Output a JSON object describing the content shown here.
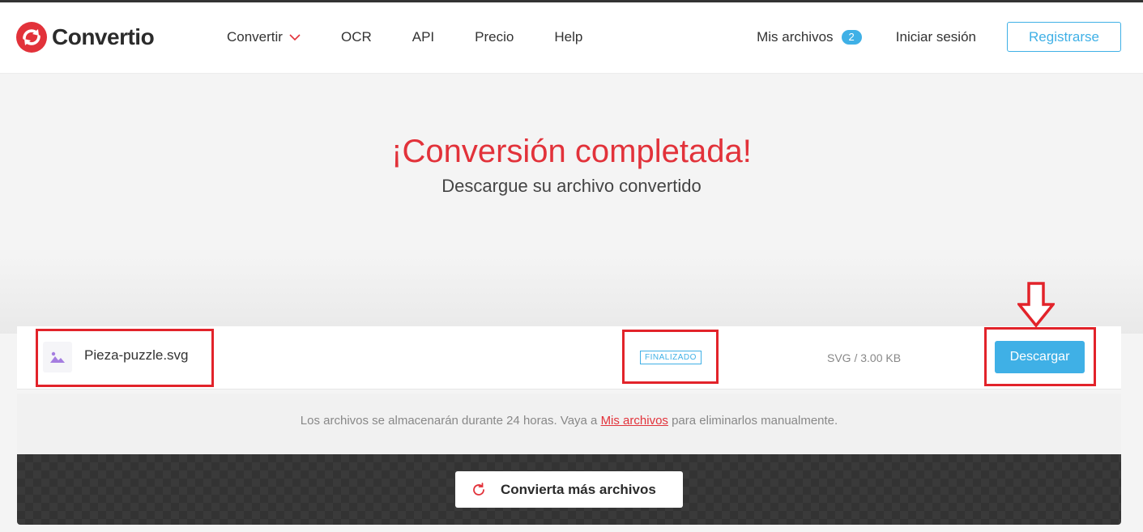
{
  "brand": {
    "name": "Convertio",
    "accent": "#e2323a",
    "blue": "#3fb0e6"
  },
  "nav": {
    "items": [
      {
        "label": "Convertir",
        "has_dropdown": true
      },
      {
        "label": "OCR"
      },
      {
        "label": "API"
      },
      {
        "label": "Precio"
      },
      {
        "label": "Help"
      }
    ],
    "my_files_label": "Mis archivos",
    "my_files_count": "2",
    "login_label": "Iniciar sesión",
    "register_label": "Registrarse"
  },
  "hero": {
    "title": "¡Conversión completada!",
    "subtitle": "Descargue su archivo convertido"
  },
  "file": {
    "icon": "image-icon",
    "name": "Pieza-puzzle.svg",
    "status": "FINALIZADO",
    "size": "SVG / 3.00 KB",
    "download_label": "Descargar"
  },
  "notice": {
    "before": "Los archivos se almacenarán durante 24 horas. Vaya a ",
    "link": "Mis archivos",
    "after": " para eliminarlos manualmente."
  },
  "more": {
    "label": "Convierta más archivos",
    "icon": "refresh-icon"
  }
}
